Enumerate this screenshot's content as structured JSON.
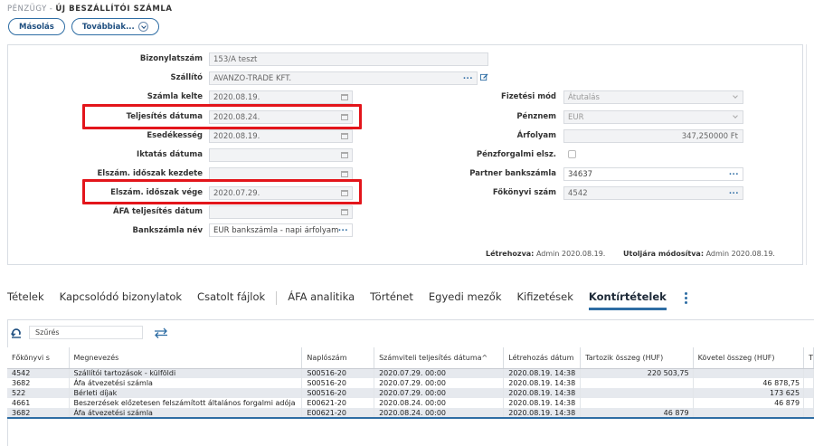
{
  "breadcrumb": {
    "section": "PÉNZÜGY",
    "separator": "-",
    "page": "ÚJ BESZÁLLÍTÓI SZÁMLA"
  },
  "toolbar": {
    "copy_label": "Másolás",
    "more_label": "Továbbiak..."
  },
  "form": {
    "bizonylatszam": {
      "label": "Bizonylatszám",
      "value": "153/A teszt"
    },
    "szallito": {
      "label": "Szállító",
      "value": "AVANZO-TRADE KFT.",
      "dots": "..."
    },
    "szamla_kelte": {
      "label": "Számla kelte",
      "value": "2020.08.19."
    },
    "teljesites_datuma": {
      "label": "Teljesítés dátuma",
      "value": "2020.08.24."
    },
    "esedekesseg": {
      "label": "Esedékesség",
      "value": "2020.08.19."
    },
    "iktatas_datuma": {
      "label": "Iktatás dátuma",
      "value": ""
    },
    "elszam_kezdete": {
      "label": "Elszám. időszak kezdete",
      "value": ""
    },
    "elszam_vege": {
      "label": "Elszám. időszak vége",
      "value": "2020.07.29."
    },
    "afa_teljesites": {
      "label": "ÁFA teljesítés dátum",
      "value": ""
    },
    "bankszamla_nev": {
      "label": "Bankszámla név",
      "value": "EUR bankszámla - napi árfolyam",
      "dots": "..."
    },
    "fizetesi_mod": {
      "label": "Fizetési mód",
      "value": "Átutalás"
    },
    "penznem": {
      "label": "Pénznem",
      "value": "EUR"
    },
    "arfolyam": {
      "label": "Árfolyam",
      "value": "347,250000 Ft"
    },
    "penzforgalmi": {
      "label": "Pénzforgalmi elsz."
    },
    "partner_bankszamla": {
      "label": "Partner bankszámla",
      "value": "34637",
      "dots": "..."
    },
    "fokonyvi_szam": {
      "label": "Főkönyvi szám",
      "value": "4542",
      "dots": "..."
    }
  },
  "meta": {
    "created_label": "Létrehozva:",
    "created_value": "Admin 2020.08.19.",
    "modified_label": "Utoljára módosítva:",
    "modified_value": "Admin 2020.08.19."
  },
  "tabs": [
    {
      "label": "Tételek"
    },
    {
      "label": "Kapcsolódó bizonylatok"
    },
    {
      "label": "Csatolt fájlok"
    },
    {
      "label": "ÁFA analitika"
    },
    {
      "label": "Történet"
    },
    {
      "label": "Egyedi mezők"
    },
    {
      "label": "Kifizetések"
    },
    {
      "label": "Kontírtételek"
    }
  ],
  "grid": {
    "filter_placeholder": "Szűrés",
    "columns": [
      "Főkönyvi s",
      "Megnevezés",
      "Naplószám",
      "Számviteli teljesítés dátuma",
      "Létrehozás dátum",
      "Tartozik összeg (HUF)",
      "Követel összeg (HUF)",
      "T"
    ],
    "sort_indicator": "^",
    "rows": [
      [
        "4542",
        "Szállítói tartozások - külföldi",
        "S00516-20",
        "2020.07.29. 00:00",
        "2020.08.19. 14:38",
        "220 503,75",
        ""
      ],
      [
        "3682",
        "Áfa átvezetési számla",
        "S00516-20",
        "2020.07.29. 00:00",
        "2020.08.19. 14:38",
        "",
        "46 878,75"
      ],
      [
        "522",
        "Bérleti díjak",
        "S00516-20",
        "2020.07.29. 00:00",
        "2020.08.19. 14:38",
        "",
        "173 625"
      ],
      [
        "4661",
        "Beszerzések előzetesen felszámított általános forgalmi adója",
        "E00621-20",
        "2020.08.24. 00:00",
        "2020.08.19. 14:38",
        "",
        "46 879"
      ],
      [
        "3682",
        "Áfa átvezetési számla",
        "E00621-20",
        "2020.08.24. 00:00",
        "2020.08.19. 14:38",
        "46 879",
        ""
      ]
    ]
  },
  "colors": {
    "accent": "#2e6da4",
    "highlight": "#e3151b"
  }
}
